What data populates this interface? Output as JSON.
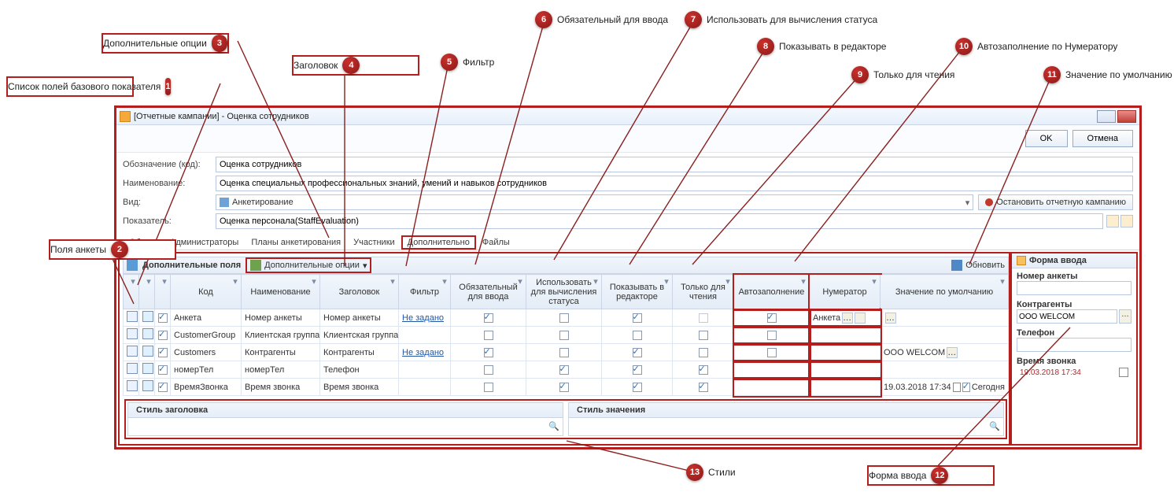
{
  "callouts": {
    "c1": "Список полей базового показателя",
    "c2": "Поля анкеты",
    "c3": "Дополнительные опции",
    "c4": "Заголовок",
    "c5": "Фильтр",
    "c6": "Обязательный для ввода",
    "c7": "Использовать для вычисления статуса",
    "c8": "Показывать в редакторе",
    "c9": "Только для чтения",
    "c10": "Автозаполнение по Нумератору",
    "c11": "Значение по умолчанию",
    "c12": "Форма ввода",
    "c13": "Стили"
  },
  "window": {
    "title": "[Отчетные кампании] - Оценка сотрудников",
    "ok": "OK",
    "cancel": "Отмена"
  },
  "form": {
    "code_label": "Обозначение (код):",
    "code_value": "Оценка сотрудников",
    "name_label": "Наименование:",
    "name_value": "Оценка специальных профессиональных знаний, умений и навыков сотрудников",
    "kind_label": "Вид:",
    "kind_value": "Анкетирование",
    "stop_btn": "Остановить отчетную кампанию",
    "indicator_label": "Показатель:",
    "indicator_value": "Оценка персонала(StaffEvaluation)"
  },
  "tabs": [
    "Общее",
    "Администраторы",
    "Планы анкетирования",
    "Участники",
    "Дополнительно",
    "Файлы"
  ],
  "toolbar": {
    "title": "Дополнительные поля",
    "opts": "Дополнительные опции",
    "refresh": "Обновить"
  },
  "columns": {
    "code": "Код",
    "name": "Наименование",
    "title": "Заголовок",
    "filter": "Фильтр",
    "required": "Обязательный для ввода",
    "usestatus": "Использовать для вычисления статуса",
    "showeditor": "Показывать в редакторе",
    "readonly": "Только для чтения",
    "autofill": "Автозаполнение",
    "numerator": "Нумератор",
    "default": "Значение по умолчанию"
  },
  "rows": [
    {
      "code": "Анкета",
      "name": "Номер анкеты",
      "title": "Номер анкеты",
      "filter": "Не задано",
      "req": true,
      "use": false,
      "show": true,
      "ro": false,
      "ro_dim": true,
      "auto": true,
      "num": "Анкета",
      "def": "",
      "def_btn": true
    },
    {
      "code": "CustomerGroup",
      "name": "Клиентская группа",
      "title": "Клиентская группа",
      "filter": "",
      "req": false,
      "use": false,
      "show": false,
      "ro": false,
      "auto": false,
      "num": "",
      "def": ""
    },
    {
      "code": "Customers",
      "name": "Контрагенты",
      "title": "Контрагенты",
      "filter": "Не задано",
      "req": true,
      "use": false,
      "show": true,
      "ro": false,
      "auto": false,
      "num": "",
      "def": "OOO WELCOM",
      "def_btn": true
    },
    {
      "code": "номерТел",
      "name": "номерТел",
      "title": "Телефон",
      "filter": "",
      "req": false,
      "use": true,
      "show": true,
      "ro": true,
      "auto": null,
      "num": "",
      "def": ""
    },
    {
      "code": "ВремяЗвонка",
      "name": "Время звонка",
      "title": "Время звонка",
      "filter": "",
      "req": false,
      "use": true,
      "show": true,
      "ro": true,
      "auto": null,
      "num": "",
      "def": "19.03.2018 17:34",
      "def_extra": "Сегодня"
    }
  ],
  "styles": {
    "header": "Стиль заголовка",
    "value": "Стиль значения"
  },
  "preview": {
    "title": "Форма ввода",
    "f1": "Номер анкеты",
    "f2": "Контрагенты",
    "f2v": "OOO WELCOM",
    "f3": "Телефон",
    "f4": "Время звонка",
    "f4v": "19.03.2018 17:34"
  }
}
